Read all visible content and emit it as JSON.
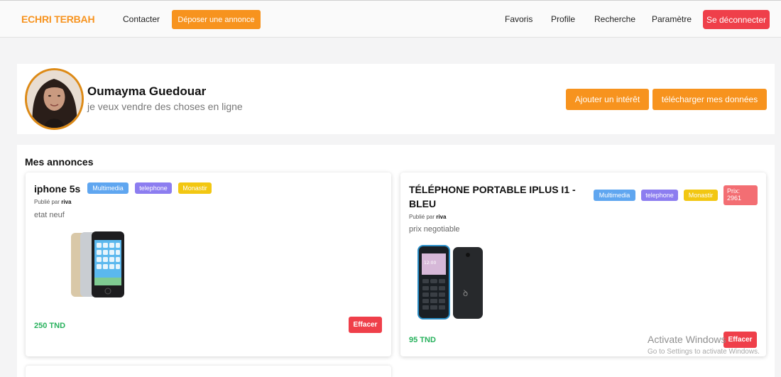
{
  "navbar": {
    "brand": "ECHRI TERBAH",
    "contact": "Contacter",
    "post_ad": "Déposer une annonce",
    "favorites": "Favoris",
    "profile": "Profile",
    "search": "Recherche",
    "settings": "Paramètre",
    "logout": "Se déconnecter"
  },
  "profile": {
    "name": "Oumayma Guedouar",
    "bio": "je veux vendre des choses en ligne",
    "add_interest": "Ajouter un intérêt",
    "download_data": "télécharger mes données"
  },
  "ads": {
    "title": "Mes annonces",
    "items": [
      {
        "title": "iphone 5s",
        "tags": [
          "Multimedia",
          "telephone",
          "Monastir"
        ],
        "posted_label": "Publié par",
        "author": "riva",
        "description": "etat neuf",
        "price": "250 TND",
        "delete_label": "Effacer"
      },
      {
        "title": "TÉLÉPHONE PORTABLE IPLUS I1 - BLEU",
        "tags": [
          "Multimedia",
          "telephone",
          "Monastir"
        ],
        "price_badge": "Prix: 2961",
        "posted_label": "Publié par",
        "author": "riva",
        "description": "prix negotiable",
        "price": "95 TND",
        "delete_label": "Effacer"
      }
    ]
  },
  "watermark": {
    "line1": "Activate Windows",
    "line2": "Go to Settings to activate Windows."
  }
}
